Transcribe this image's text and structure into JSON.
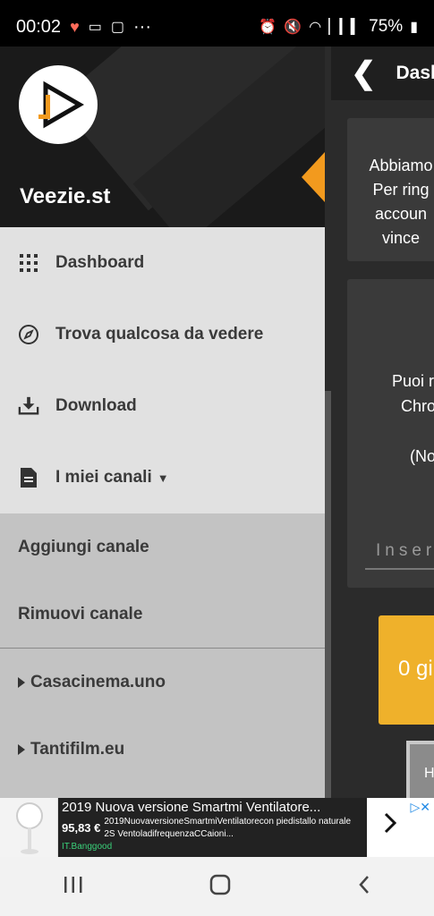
{
  "status": {
    "time": "00:02",
    "dots": "···",
    "battery": "75%"
  },
  "app_behind": {
    "title": "Dashb",
    "card1_lines": [
      "Abbiamo",
      "Per ring",
      "accoun",
      "vince"
    ],
    "card2_lines": [
      "Puoi r",
      "Chro",
      "(No"
    ],
    "input_placeholder": "Inser",
    "yellow_button": "0 gi",
    "gray_button": "H"
  },
  "drawer": {
    "site_name": "Veezie.st",
    "menu": [
      {
        "label": "Dashboard",
        "icon": "grid-icon"
      },
      {
        "label": "Trova qualcosa da vedere",
        "icon": "compass-icon"
      },
      {
        "label": "Download",
        "icon": "download-icon"
      },
      {
        "label": "I miei canali",
        "icon": "document-icon"
      }
    ],
    "submenu": [
      {
        "label": "Aggiungi canale"
      },
      {
        "label": "Rimuovi canale"
      }
    ],
    "channels": [
      {
        "label": "Casacinema.uno"
      },
      {
        "label": "Tantifilm.eu"
      }
    ]
  },
  "ad": {
    "title": "2019 Nuova versione Smartmi Ventilatore...",
    "price": "95,83 €",
    "description": "2019NuovaversioneSmartmiVentilatorecon piedistallo naturale 2S VentoladifrequenzaCCaioni...",
    "source": "IT.Banggood"
  },
  "colors": {
    "accent_orange": "#f29a1e",
    "yellow_button": "#efb12b",
    "ad_source_green": "#3ad07a"
  }
}
